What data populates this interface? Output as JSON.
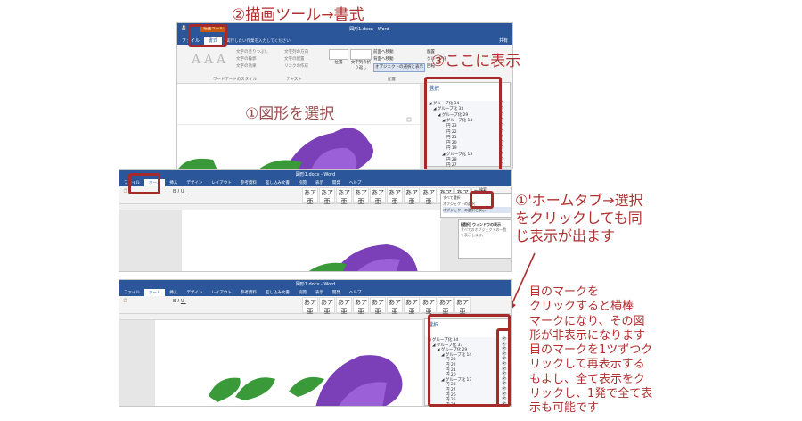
{
  "annotations": {
    "step2": "②描画ツール→書式",
    "step3": "③ここに表示",
    "step1": "①図形を選択",
    "step1b_line1": "①'ホームタブ→選択",
    "step1b_line2": "をクリックしても同",
    "step1b_line3": "じ表示が出ます",
    "note_line1": "目のマークを",
    "note_line2": "クリックすると横棒",
    "note_line3": "マークになり、その図",
    "note_line4": "形が非表示になります",
    "note_line5": "目のマークを1ツずつク",
    "note_line6": "リックして再表示する",
    "note_line7": "もよし、全て表示をク",
    "note_line8": "リックし、1発で全て表",
    "note_line9": "示も可能です"
  },
  "shot_top": {
    "title": "図形1.docx - Word",
    "context_tab": "描画ツール",
    "tabs": [
      "ファイル",
      "書式"
    ],
    "active_tab": "書式",
    "tell_me": "実行したい作業を入力してください",
    "user": "共有",
    "ribbon_groups": [
      "ワードアートのスタイル",
      "テキスト",
      "配置"
    ],
    "ribbon_items": [
      "文字の塗りつぶし",
      "文字の輪郭",
      "文字の効果",
      "文字列の方向",
      "文字の配置",
      "リンクの作成",
      "位置",
      "文字列の折り返し",
      "前面へ移動",
      "背面へ移動",
      "オブジェクトの選択と表示",
      "配置",
      "グループ化",
      "回転"
    ],
    "pane": {
      "title": "選択",
      "show_all": "すべて表示",
      "hide_all": "すべて非表示",
      "items": [
        "グループ化 34",
        "グループ化 33",
        "グループ化 29",
        "グループ化 14",
        "円 23",
        "円 22",
        "円 21",
        "円 20",
        "円 19",
        "グループ化 13",
        "円 28",
        "円 27"
      ]
    }
  },
  "shot_middle": {
    "title": "図形1.docx - Word",
    "tabs": [
      "ファイル",
      "ホーム",
      "挿入",
      "デザイン",
      "レイアウト",
      "参考資料",
      "差し込み文書",
      "校閲",
      "表示",
      "開発",
      "ヘルプ"
    ],
    "active_tab": "ホーム",
    "tell_me": "実行したい作業を入力してください",
    "styles": [
      "標準",
      "行間詰め",
      "見出し1",
      "見出し2",
      "表題",
      "副題",
      "斜体",
      "強調斜体2",
      "強調太字",
      "引用文",
      "引用文2"
    ],
    "edit_items": [
      "検索",
      "置換",
      "選択"
    ],
    "dropdown": [
      "すべて選択",
      "オブジェクトの選択",
      "オブジェクトの選択と表示"
    ],
    "tooltip_title": "[選択] ウィンドウの表示",
    "tooltip_body": "すべてのオブジェクトの一覧を表示します。"
  },
  "shot_bottom": {
    "title": "図形1.docx - Word",
    "tabs": [
      "ファイル",
      "ホーム",
      "挿入",
      "デザイン",
      "レイアウト",
      "参考資料",
      "差し込み文書",
      "校閲",
      "表示",
      "開発",
      "ヘルプ"
    ],
    "active_tab": "ホーム",
    "styles": [
      "標準",
      "行間詰め",
      "見出し1",
      "見出し2",
      "表題",
      "副題",
      "斜体",
      "強調斜体2",
      "強調太字",
      "引用文"
    ],
    "pane": {
      "title": "選択",
      "show_all": "すべて表示",
      "hide_all": "すべて非表示",
      "items": [
        "グループ化 34",
        "グループ化 33",
        "グループ化 29",
        "グループ化 14",
        "円 23",
        "円 22",
        "円 21",
        "円 20",
        "グループ化 13",
        "円 28",
        "円 27",
        "円 26",
        "円 25",
        "円 24"
      ]
    }
  },
  "colors": {
    "word_blue": "#2b579a",
    "annotation_red": "#a52a2a",
    "flower_purple": "#7b3fb7",
    "leaf_green": "#3a9a3a"
  }
}
